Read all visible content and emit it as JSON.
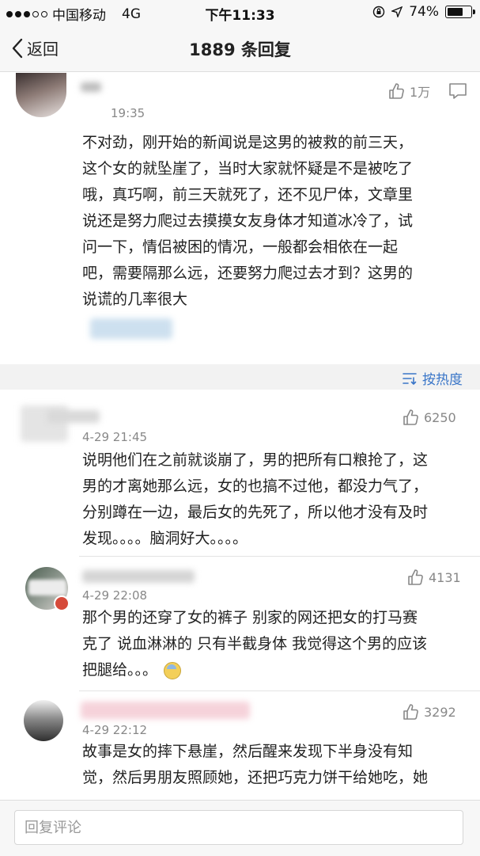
{
  "status_bar": {
    "carrier": "中国移动",
    "network": "4G",
    "time": "下午11:33",
    "battery": "74%",
    "battery_level": 0.74
  },
  "nav": {
    "back_label": "返回",
    "title": "1889 条回复"
  },
  "sort": {
    "label": "按热度"
  },
  "comments": [
    {
      "time": "19:35",
      "likes": "1万",
      "lines": [
        "不对劲，刚开始的新闻说是这男的被救的前三天，",
        "这个女的就坠崖了，当时大家就怀疑是不是被吃了",
        "哦，真巧啊，前三天就死了，还不见尸体，文章里",
        "说还是努力爬过去摸摸女友身体才知道冰冷了，试",
        "问一下，情侣被困的情况，一般都会相依在一起",
        "吧，需要隔那么远，还要努力爬过去才到？这男的",
        "说谎的几率很大"
      ]
    },
    {
      "time": "4-29 21:45",
      "likes": "6250",
      "lines": [
        "说明他们在之前就谈崩了，男的把所有口粮抢了，这",
        "男的才离她那么远，女的也搞不过他，都没力气了，",
        "分别蹲在一边，最后女的先死了，所以他才没有及时",
        "发现。。。。脑洞好大。。。。"
      ]
    },
    {
      "time": "4-29 22:08",
      "likes": "4131",
      "lines": [
        "那个男的还穿了女的裤子 别家的网还把女的打马赛",
        "克了 说血淋淋的 只有半截身体 我觉得这个男的应该",
        "把腿给。。。"
      ]
    },
    {
      "time": "4-29 22:12",
      "likes": "3292",
      "lines": [
        "故事是女的摔下悬崖，然后醒来发现下半身没有知",
        "觉，然后男朋友照顾她，还把巧克力饼干给她吃，她"
      ]
    }
  ],
  "reply_input": {
    "placeholder": "回复评论"
  },
  "colors": {
    "accent": "#3a76c8",
    "muted": "#888888",
    "separator": "#f2f2f2"
  }
}
